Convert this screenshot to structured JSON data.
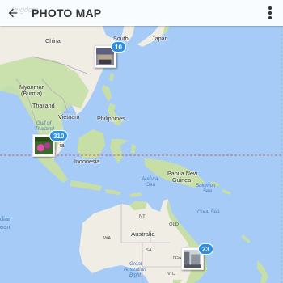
{
  "faint_title": "Kingdom",
  "header": {
    "title": "PHOTO MAP",
    "back_icon": "arrow-back-icon",
    "menu_icon": "more-vert-icon"
  },
  "labels": {
    "china": "China",
    "south": "South",
    "japan": "Japan",
    "myanmar": "Myanmar",
    "burma": "(Burma)",
    "thailand": "Thailand",
    "vietnam": "Vietnam",
    "philippines": "Philippines",
    "gulf1": "Gulf of",
    "gulf2": "Thailand",
    "malaysia": "ia",
    "indonesia": "Indonesia",
    "png1": "Papua New",
    "png2": "Guinea",
    "arafura1": "Arafura",
    "arafura2": "Sea",
    "solomon1": "Solomon",
    "solomon2": "Sea",
    "coral": "Coral Sea",
    "australia": "Australia",
    "wa": "WA",
    "nt": "NT",
    "qld": "QLD",
    "sa": "SA",
    "nsw": "NSW",
    "vic": "VIC",
    "gab1": "Great",
    "gab2": "Australian",
    "gab3": "Bight",
    "indian1": "dian",
    "indian2": "ean"
  },
  "clusters": [
    {
      "count": "10"
    },
    {
      "count": "310"
    },
    {
      "count": "23"
    }
  ],
  "colors": {
    "water": "#a6cbf7",
    "land": "#f0ede5",
    "vegetation": "#c7dfa6",
    "badge": "#2c8fe3",
    "equator": "#c54a4a"
  }
}
